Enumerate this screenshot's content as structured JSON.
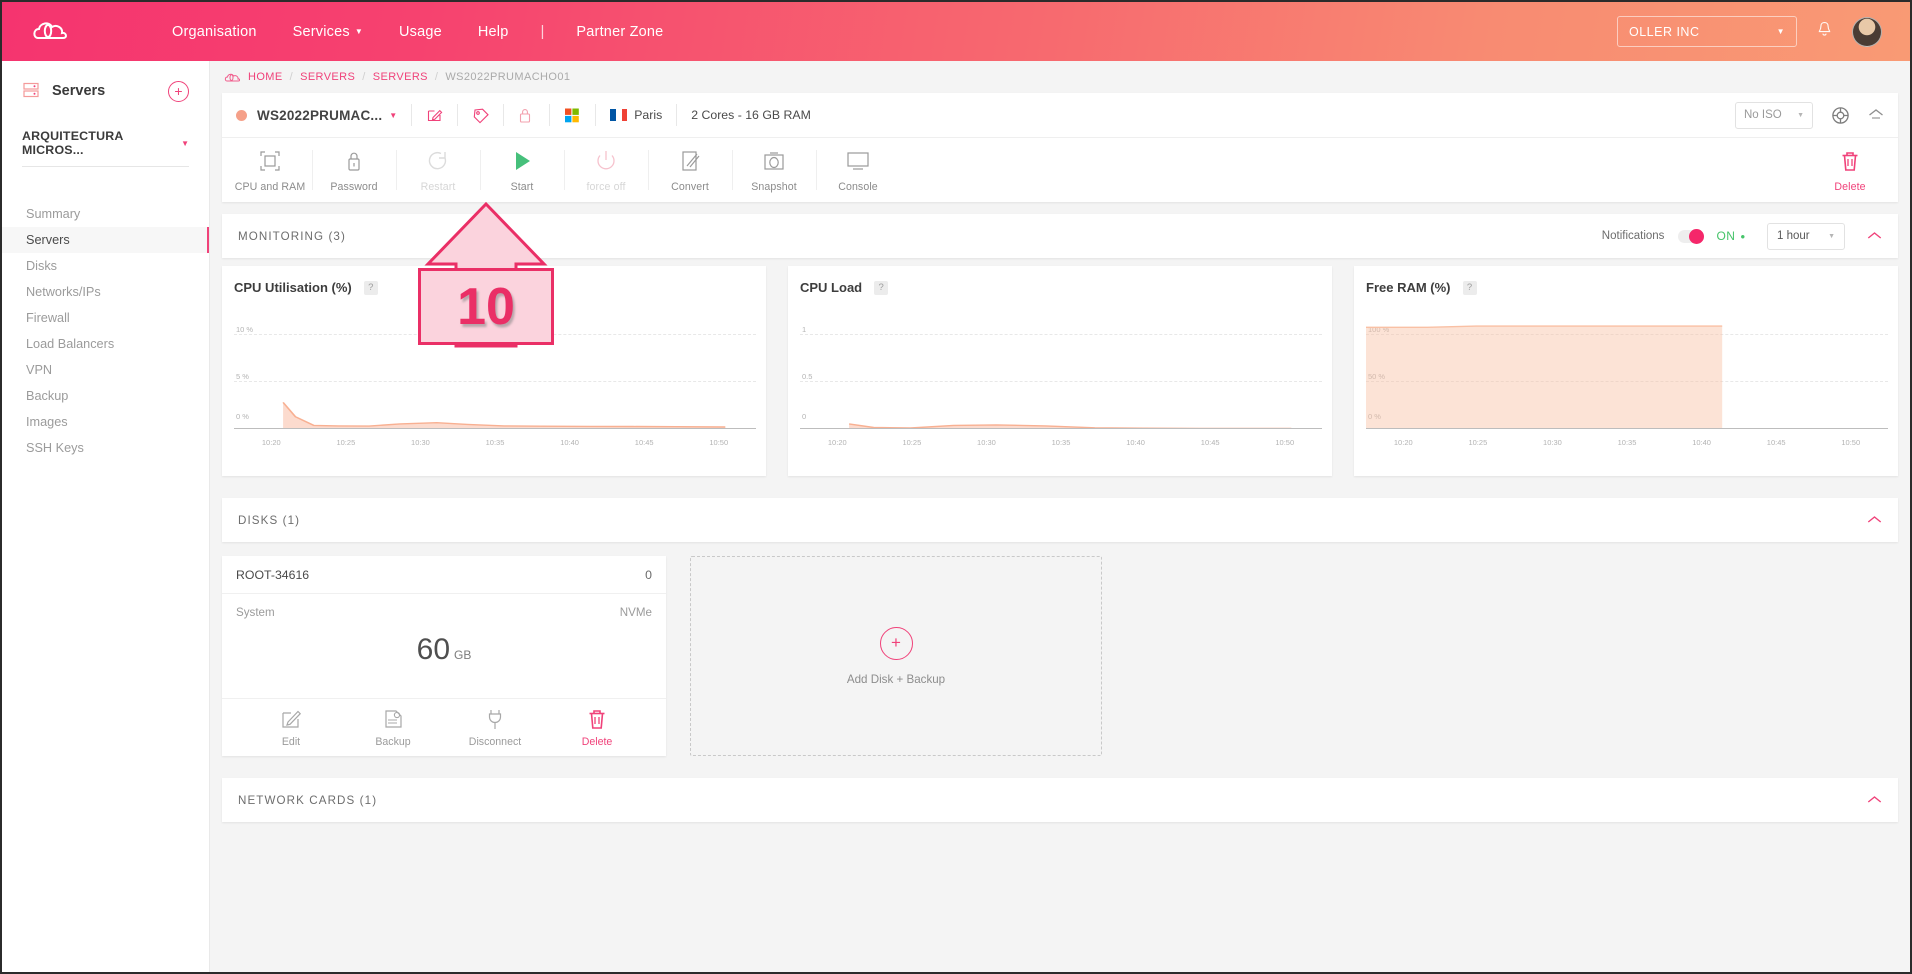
{
  "topbar": {
    "logo_icon": "cloud-logo-icon",
    "nav": [
      {
        "label": "Organisation",
        "caret": false
      },
      {
        "label": "Services",
        "caret": true
      },
      {
        "label": "Usage",
        "caret": false
      },
      {
        "label": "Help",
        "caret": false
      },
      {
        "label": "Partner Zone",
        "caret": false
      }
    ],
    "separator": "|",
    "org_selector": {
      "value": "OLLER INC",
      "caret": "▼"
    },
    "bell_icon": "notification-bell-icon",
    "avatar_icon": "user-avatar"
  },
  "sidebar": {
    "header": {
      "icon": "servers-icon",
      "title": "Servers",
      "add_label": "+"
    },
    "context": {
      "value": "ARQUITECTURA MICROS...",
      "caret": "▼"
    },
    "items": [
      {
        "label": "Summary",
        "active": false
      },
      {
        "label": "Servers",
        "active": true
      },
      {
        "label": "Disks",
        "active": false
      },
      {
        "label": "Networks/IPs",
        "active": false
      },
      {
        "label": "Firewall",
        "active": false
      },
      {
        "label": "Load Balancers",
        "active": false
      },
      {
        "label": "VPN",
        "active": false
      },
      {
        "label": "Backup",
        "active": false
      },
      {
        "label": "Images",
        "active": false
      },
      {
        "label": "SSH Keys",
        "active": false
      }
    ]
  },
  "breadcrumb": {
    "icon": "cloud-small-icon",
    "items": [
      "HOME",
      "SERVERS",
      "SERVERS"
    ],
    "current": "WS2022PRUMACHO01",
    "separator": "/"
  },
  "server_header": {
    "status_color": "#f5a089",
    "name": "WS2022PRUMAC...",
    "name_caret": "▼",
    "edit_icon": "edit-pencil-icon",
    "tag_icon": "tag-icon",
    "lock_icon": "lock-icon",
    "os_icon": "windows-logo-icon",
    "region_flag": "france-flag-icon",
    "region": "Paris",
    "specs": "2 Cores - 16 GB RAM",
    "iso_selector": {
      "value": "No ISO",
      "caret": "▼"
    },
    "support_icon": "lifebuoy-icon",
    "collapse_icon": "chevron-up-icon"
  },
  "toolbar": {
    "actions": [
      {
        "label": "CPU and RAM",
        "icon": "resize-icon",
        "disabled": false
      },
      {
        "label": "Password",
        "icon": "lock-icon",
        "disabled": false
      },
      {
        "label": "Restart",
        "icon": "restart-icon",
        "disabled": true
      },
      {
        "label": "Start",
        "icon": "play-icon",
        "disabled": false
      },
      {
        "label": "force off",
        "icon": "power-icon",
        "disabled": true
      },
      {
        "label": "Convert",
        "icon": "convert-pencil-icon",
        "disabled": false
      },
      {
        "label": "Snapshot",
        "icon": "camera-icon",
        "disabled": false
      },
      {
        "label": "Console",
        "icon": "monitor-icon",
        "disabled": false
      }
    ],
    "delete": {
      "label": "Delete",
      "icon": "trash-icon"
    }
  },
  "monitoring": {
    "title": "MONITORING (3)",
    "notifications_label": "Notifications",
    "toggle_state": "ON",
    "toggle_color": "#f5276a",
    "on_color": "#46c46a",
    "range": {
      "value": "1 hour",
      "caret": "▼"
    },
    "collapse_icon": "chevron-up-icon"
  },
  "chart_data": [
    {
      "type": "area",
      "title": "CPU Utilisation (%)",
      "help_label": "?",
      "xlabel": "",
      "ylabel": "",
      "yticks": [
        "10 %",
        "5 %",
        "0 %"
      ],
      "ylim": [
        0,
        12.5
      ],
      "xticks": [
        "10:20",
        "10:25",
        "10:30",
        "10:35",
        "10:40",
        "10:45",
        "10:50"
      ],
      "grid": true,
      "series_color": "#f8b092",
      "x": [
        10.28,
        10.3,
        10.33,
        10.37,
        10.42,
        10.47,
        10.53,
        10.58,
        10.64,
        10.7,
        10.78,
        10.85,
        10.92,
        11.0
      ],
      "values": [
        2.6,
        1.2,
        0.35,
        0.3,
        0.28,
        0.5,
        0.62,
        0.45,
        0.3,
        0.27,
        0.25,
        0.24,
        0.22,
        0.2
      ]
    },
    {
      "type": "area",
      "title": "CPU Load",
      "help_label": "?",
      "xlabel": "",
      "ylabel": "",
      "yticks": [
        "1",
        "0.5",
        "0"
      ],
      "ylim": [
        0,
        1.25
      ],
      "xticks": [
        "10:20",
        "10:25",
        "10:30",
        "10:35",
        "10:40",
        "10:45",
        "10:50"
      ],
      "grid": true,
      "series_color": "#f8b092",
      "x": [
        10.28,
        10.32,
        10.38,
        10.45,
        10.52,
        10.6,
        10.68,
        10.76,
        10.85,
        11.0
      ],
      "values": [
        0.05,
        0.015,
        0.01,
        0.035,
        0.04,
        0.03,
        0.012,
        0.008,
        0.006,
        0.005
      ]
    },
    {
      "type": "area",
      "title": "Free RAM (%)",
      "help_label": "?",
      "xlabel": "",
      "ylabel": "",
      "yticks": [
        "100 %",
        "50 %",
        "0 %"
      ],
      "ylim": [
        0,
        112
      ],
      "xticks": [
        "10:20",
        "10:25",
        "10:30",
        "10:35",
        "10:40",
        "10:45",
        "10:50"
      ],
      "grid": true,
      "series_color": "#f9c0a4",
      "x": [
        10.2,
        10.3,
        10.38,
        10.5,
        10.62,
        10.72,
        10.78
      ],
      "values": [
        89,
        89,
        90,
        90,
        90,
        90,
        90
      ]
    }
  ],
  "disks": {
    "title": "DISKS (1)",
    "collapse_icon": "chevron-up-icon",
    "disk": {
      "name": "ROOT-34616",
      "number": "0",
      "type_left": "System",
      "type_right": "NVMe",
      "size_value": "60",
      "size_unit": "GB",
      "actions": [
        {
          "label": "Edit",
          "icon": "edit-pencil-icon",
          "danger": false
        },
        {
          "label": "Backup",
          "icon": "backup-disk-icon",
          "danger": false
        },
        {
          "label": "Disconnect",
          "icon": "plug-icon",
          "danger": false
        },
        {
          "label": "Delete",
          "icon": "trash-icon",
          "danger": true
        }
      ]
    },
    "add_placeholder": {
      "plus": "+",
      "label": "Add Disk + Backup"
    }
  },
  "network_cards": {
    "title": "NETWORK CARDS (1)",
    "collapse_icon": "chevron-up-icon"
  },
  "annotation": {
    "step_number": "10",
    "border_color": "#ea2f66",
    "fill_color": "#fbd3dd"
  }
}
